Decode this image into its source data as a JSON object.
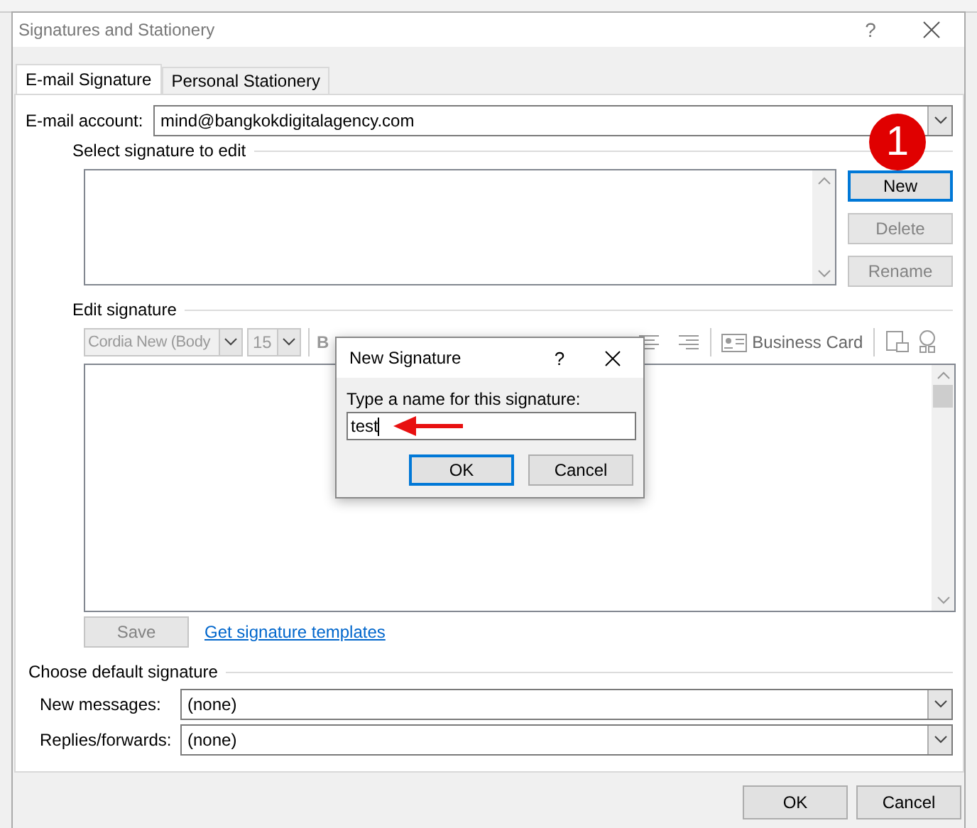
{
  "window": {
    "title": "Signatures and Stationery",
    "help": "?"
  },
  "tabs": [
    {
      "label": "E-mail Signature",
      "selected": true
    },
    {
      "label": "Personal Stationery",
      "selected": false
    }
  ],
  "email_account": {
    "label": "E-mail account:",
    "value": "mind@bangkokdigitalagency.com"
  },
  "select_signature": {
    "heading": "Select signature to edit",
    "buttons": [
      {
        "label": "New",
        "disabled": false,
        "focused": true
      },
      {
        "label": "Delete",
        "disabled": true,
        "focused": false
      },
      {
        "label": "Rename",
        "disabled": true,
        "focused": false
      }
    ]
  },
  "annotation_badge": {
    "text": "1"
  },
  "edit_signature": {
    "heading": "Edit signature",
    "font": "Cordia New (Body",
    "size": "15",
    "bold": "B",
    "business_card": "Business Card",
    "save": {
      "label": "Save",
      "disabled": true
    },
    "templates_link": "Get signature templates"
  },
  "default_signature": {
    "heading": "Choose default signature",
    "fields": [
      {
        "label": "New messages:",
        "value": "(none)"
      },
      {
        "label": "Replies/forwards:",
        "value": "(none)"
      }
    ]
  },
  "footer_buttons": [
    {
      "label": "OK"
    },
    {
      "label": "Cancel"
    }
  ],
  "new_signature_dialog": {
    "title": "New Signature",
    "help": "?",
    "prompt": "Type a name for this signature:",
    "value": "test",
    "buttons": [
      {
        "label": "OK",
        "default": true
      },
      {
        "label": "Cancel",
        "default": false
      }
    ]
  }
}
